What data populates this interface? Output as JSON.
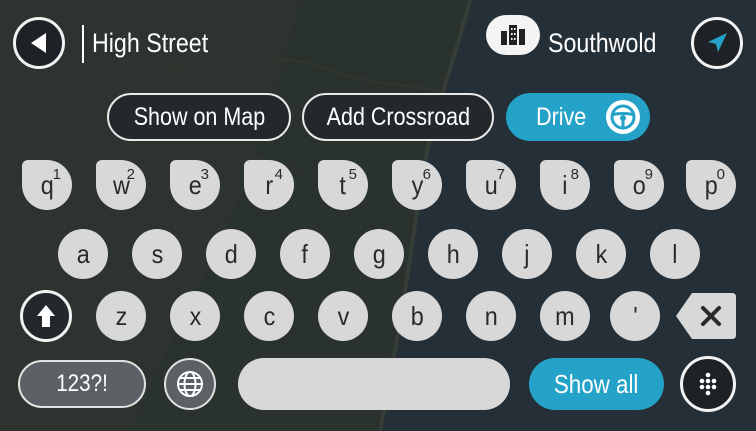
{
  "header": {
    "search_value": "High Street",
    "city": "Southwold"
  },
  "actions": {
    "show_on_map": "Show on Map",
    "add_crossroad": "Add Crossroad",
    "drive": "Drive"
  },
  "keyboard": {
    "row1": [
      {
        "ch": "q",
        "sup": "1"
      },
      {
        "ch": "w",
        "sup": "2"
      },
      {
        "ch": "e",
        "sup": "3"
      },
      {
        "ch": "r",
        "sup": "4"
      },
      {
        "ch": "t",
        "sup": "5"
      },
      {
        "ch": "y",
        "sup": "6"
      },
      {
        "ch": "u",
        "sup": "7"
      },
      {
        "ch": "i",
        "sup": "8"
      },
      {
        "ch": "o",
        "sup": "9"
      },
      {
        "ch": "p",
        "sup": "0"
      }
    ],
    "row2": [
      "a",
      "s",
      "d",
      "f",
      "g",
      "h",
      "j",
      "k",
      "l"
    ],
    "row3": [
      "z",
      "x",
      "c",
      "v",
      "b",
      "n",
      "m",
      "'"
    ],
    "numbers_label": "123?!",
    "show_all_label": "Show all"
  },
  "colors": {
    "accent": "#25a2c7",
    "key": "#d8d8d8",
    "dark": "#1e2226"
  }
}
